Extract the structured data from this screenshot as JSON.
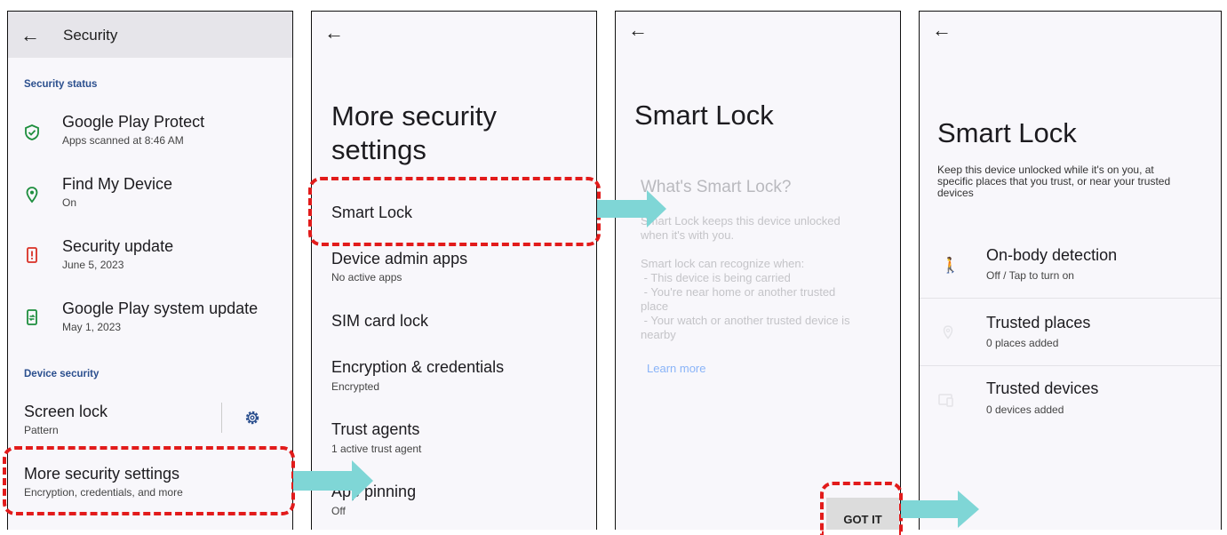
{
  "screen1": {
    "title": "Security",
    "section_status": "Security status",
    "items": [
      {
        "label": "Google Play Protect",
        "sub": "Apps scanned at 8:46 AM"
      },
      {
        "label": "Find My Device",
        "sub": "On"
      },
      {
        "label": "Security update",
        "sub": "June 5, 2023"
      },
      {
        "label": "Google Play system update",
        "sub": "May 1, 2023"
      }
    ],
    "section_device": "Device security",
    "screen_lock": {
      "label": "Screen lock",
      "sub": "Pattern"
    },
    "more": {
      "label": "More security settings",
      "sub": "Encryption, credentials, and more"
    }
  },
  "screen2": {
    "title_line1": "More security",
    "title_line2": "settings",
    "items": [
      {
        "label": "Smart Lock",
        "sub": ""
      },
      {
        "label": "Device admin apps",
        "sub": "No active apps"
      },
      {
        "label": "SIM card lock",
        "sub": ""
      },
      {
        "label": "Encryption & credentials",
        "sub": "Encrypted"
      },
      {
        "label": "Trust agents",
        "sub": "1 active trust agent"
      },
      {
        "label": "App pinning",
        "sub": "Off"
      }
    ]
  },
  "screen3": {
    "title": "Smart Lock",
    "dialog_title": "What's Smart Lock?",
    "intro_line1": "Smart Lock keeps this device unlocked",
    "intro_line2": "when it's with you.",
    "recognize": "Smart lock can recognize when:",
    "bullet1": " - This device is being carried",
    "bullet2a": " - You're near home or another trusted",
    "bullet2b": "place",
    "bullet3a": " - Your watch or another trusted device is",
    "bullet3b": "nearby",
    "learn_more": "Learn more",
    "got_it": "GOT IT"
  },
  "screen4": {
    "title": "Smart Lock",
    "desc_line1": "Keep this device unlocked while it's on you, at",
    "desc_line2": "specific places that you trust, or near your trusted",
    "desc_line3": "devices",
    "items": [
      {
        "label": "On-body detection",
        "sub": "Off / Tap to turn on",
        "icon": "walking-icon"
      },
      {
        "label": "Trusted places",
        "sub": "0 places added",
        "icon": "location-icon"
      },
      {
        "label": "Trusted devices",
        "sub": "0 devices added",
        "icon": "devices-icon"
      }
    ]
  },
  "colors": {
    "highlight": "#e21b1b",
    "arrow": "#7fd6d6",
    "icon_green": "#1e8e3e",
    "icon_red": "#d93025",
    "section_blue": "#2b4f8e",
    "link_blue": "#8ab4f8"
  }
}
